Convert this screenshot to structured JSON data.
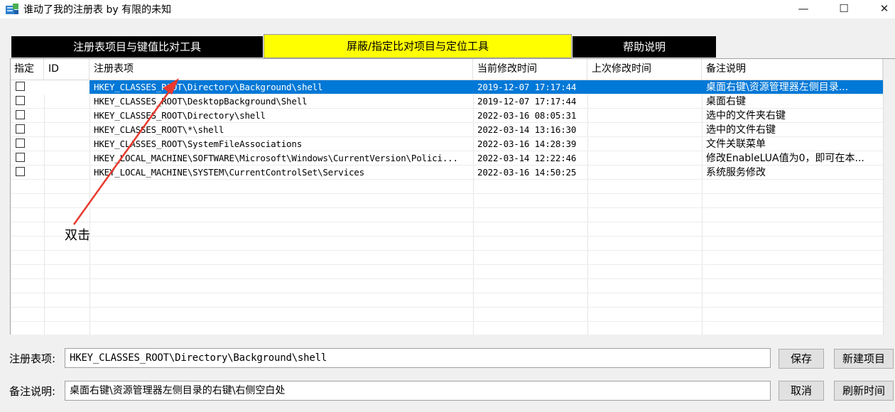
{
  "window": {
    "title": "谁动了我的注册表  by 有限的未知",
    "minimize_glyph": "—",
    "maximize_glyph": "☐",
    "close_glyph": "✕"
  },
  "tabs": [
    {
      "label": "注册表项目与键值比对工具",
      "active": false
    },
    {
      "label": "屏蔽/指定比对项目与定位工具",
      "active": true
    },
    {
      "label": "帮助说明",
      "active": false
    }
  ],
  "grid": {
    "columns": [
      "指定",
      "ID",
      "注册表项",
      "当前修改时间",
      "上次修改时间",
      "备注说明"
    ],
    "rows": [
      {
        "checked": false,
        "id": "",
        "key": "HKEY_CLASSES_ROOT\\Directory\\Background\\shell",
        "current_time": "2019-12-07 17:17:44",
        "last_time": "",
        "note": "桌面右键\\资源管理器左侧目录...",
        "selected": true
      },
      {
        "checked": false,
        "id": "",
        "key": "HKEY_CLASSES_ROOT\\DesktopBackground\\Shell",
        "current_time": "2019-12-07 17:17:44",
        "last_time": "",
        "note": "桌面右键",
        "selected": false
      },
      {
        "checked": false,
        "id": "",
        "key": "HKEY_CLASSES_ROOT\\Directory\\shell",
        "current_time": "2022-03-16 08:05:31",
        "last_time": "",
        "note": "选中的文件夹右键",
        "selected": false
      },
      {
        "checked": false,
        "id": "",
        "key": "HKEY_CLASSES_ROOT\\*\\shell",
        "current_time": "2022-03-14 13:16:30",
        "last_time": "",
        "note": "选中的文件右键",
        "selected": false
      },
      {
        "checked": false,
        "id": "",
        "key": "HKEY_CLASSES_ROOT\\SystemFileAssociations",
        "current_time": "2022-03-16 14:28:39",
        "last_time": "",
        "note": "文件关联菜单",
        "selected": false
      },
      {
        "checked": false,
        "id": "",
        "key": "HKEY_LOCAL_MACHINE\\SOFTWARE\\Microsoft\\Windows\\CurrentVersion\\Polici...",
        "current_time": "2022-03-14 12:22:46",
        "last_time": "",
        "note": "修改EnableLUA值为0，即可在本...",
        "selected": false
      },
      {
        "checked": false,
        "id": "",
        "key": "HKEY_LOCAL_MACHINE\\SYSTEM\\CurrentControlSet\\Services",
        "current_time": "2022-03-16 14:50:25",
        "last_time": "",
        "note": "系统服务修改",
        "selected": false
      }
    ]
  },
  "annotation": {
    "text": "双击",
    "color": "#e8392e"
  },
  "form": {
    "key_label": "注册表项:",
    "key_value": "HKEY_CLASSES_ROOT\\Directory\\Background\\shell",
    "note_label": "备注说明:",
    "note_value": "桌面右键\\资源管理器左侧目录的右键\\右侧空白处"
  },
  "buttons": {
    "save": "保存",
    "new_item": "新建项目",
    "cancel": "取消",
    "refresh_time": "刷新时间"
  },
  "colors": {
    "active_tab": "#ffff00",
    "inactive_tab": "#000000",
    "selection": "#0078d7"
  }
}
